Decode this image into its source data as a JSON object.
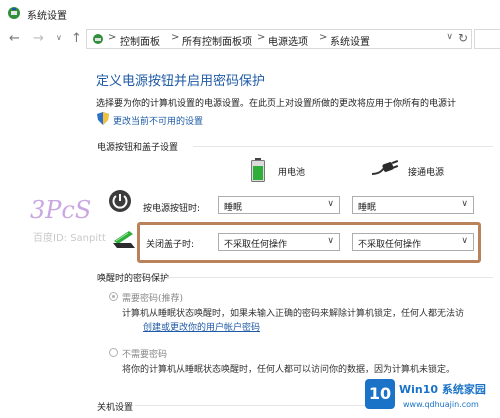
{
  "window": {
    "title": "系统设置",
    "app_icon": "power-options-icon"
  },
  "nav": {
    "back_icon": "back-arrow-icon",
    "forward_icon": "forward-arrow-icon",
    "recent_icon": "chevron-down-icon",
    "up_icon": "up-arrow-icon"
  },
  "address_bar": {
    "breadcrumbs": [
      "控制面板",
      "所有控制面板项",
      "电源选项",
      "系统设置"
    ],
    "separator": ">",
    "dropdown_icon": "chevron-down-icon",
    "refresh_icon": "refresh-icon"
  },
  "main": {
    "heading": "定义电源按钮并启用密码保护",
    "description": "选择要为你的计算机设置的电源设置。在此页上对设置所做的更改将应用于你所有的电源计",
    "change_link": "更改当前不可用的设置",
    "power_section": {
      "header": "电源按钮和盖子设置",
      "columns": [
        "用电池",
        "接通电源"
      ],
      "rows": [
        {
          "label": "按电源按钮时:",
          "battery": "睡眠",
          "plugged": "睡眠"
        },
        {
          "label": "关闭盖子时:",
          "battery": "不采取任何操作",
          "plugged": "不采取任何操作"
        }
      ]
    },
    "password_section": {
      "header": "唤醒时的密码保护",
      "require": {
        "label": "需要密码(推荐)",
        "desc1": "计算机从睡眠状态唤醒时，如果未输入正确的密码来解除计算机锁定，任何人都无法访",
        "link": "创建或更改你的用户帐户密码"
      },
      "no_require": {
        "label": "不需要密码",
        "desc": "将你的计算机从睡眠状态唤醒时，任何人都可以访问你的数据，因为计算机未锁定。"
      }
    },
    "shutdown_section": {
      "header": "关机设置"
    }
  },
  "watermark": {
    "signature": "3PcS",
    "text": "百度ID: Sanpitt"
  },
  "site_logo": {
    "badge": "10",
    "name": "Win10 系统家园",
    "url": "www.qdhuajin.com"
  },
  "colors": {
    "accent": "#1e5aa6",
    "highlight_border": "#b9825a"
  }
}
